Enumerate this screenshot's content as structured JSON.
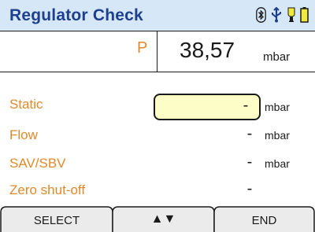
{
  "window": {
    "title": "Regulator Check",
    "colors": {
      "accent": "#1d3f8f",
      "label": "#e08a2a",
      "input_bg": "#fdfdc8",
      "title_bg": "#d6e8f7"
    },
    "status_icons": [
      "bluetooth-icon",
      "usb-icon",
      "bulb-icon",
      "battery-icon"
    ]
  },
  "pressure": {
    "label": "P",
    "value": "38,57",
    "unit": "mbar"
  },
  "params": [
    {
      "label": "Static",
      "value": "-",
      "unit": "mbar",
      "selected": true
    },
    {
      "label": "Flow",
      "value": "-",
      "unit": "mbar"
    },
    {
      "label": "SAV/SBV",
      "value": "-",
      "unit": "mbar"
    },
    {
      "label": "Zero shut-off",
      "value": "-",
      "unit": ""
    }
  ],
  "softkeys": {
    "left": "SELECT",
    "middle": "▲▼",
    "right": "END"
  }
}
